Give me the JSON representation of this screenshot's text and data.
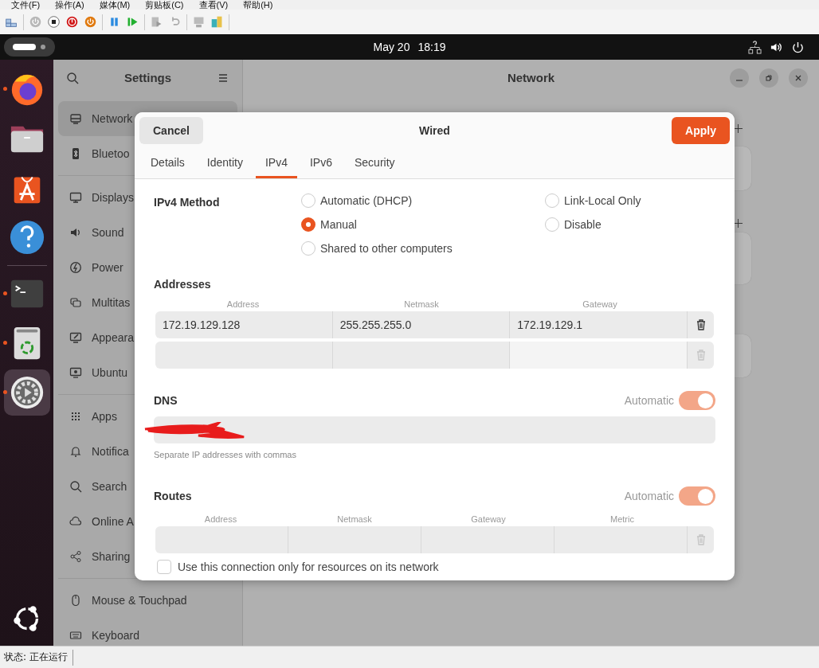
{
  "host_menu": [
    "文件(F)",
    "操作(A)",
    "媒体(M)",
    "剪贴板(C)",
    "查看(V)",
    "帮助(H)"
  ],
  "top_bar": {
    "date": "May 20",
    "time": "18:19"
  },
  "dock": [
    {
      "kind": "firefox",
      "running": true,
      "selected": false
    },
    {
      "kind": "files",
      "running": false,
      "selected": false
    },
    {
      "kind": "app-center",
      "running": false,
      "selected": false
    },
    {
      "kind": "help",
      "running": false,
      "selected": false
    },
    {
      "kind": "separator"
    },
    {
      "kind": "terminal",
      "running": true,
      "selected": false
    },
    {
      "kind": "trash",
      "running": true,
      "selected": false
    },
    {
      "kind": "settings",
      "running": true,
      "selected": true
    }
  ],
  "settings": {
    "title": "Settings",
    "groups": [
      [
        {
          "label": "Network",
          "selected": true
        },
        {
          "label": "Bluetoo",
          "selected": false
        }
      ],
      [
        {
          "label": "Displays",
          "selected": false
        },
        {
          "label": "Sound",
          "selected": false
        },
        {
          "label": "Power",
          "selected": false
        },
        {
          "label": "Multitas",
          "selected": false
        },
        {
          "label": "Appeara",
          "selected": false
        },
        {
          "label": "Ubuntu",
          "selected": false
        }
      ],
      [
        {
          "label": "Apps",
          "selected": false
        },
        {
          "label": "Notifica",
          "selected": false
        },
        {
          "label": "Search",
          "selected": false
        },
        {
          "label": "Online A",
          "selected": false
        },
        {
          "label": "Sharing",
          "selected": false
        }
      ],
      [
        {
          "label": "Mouse & Touchpad",
          "selected": false
        },
        {
          "label": "Keyboard",
          "selected": false
        }
      ]
    ]
  },
  "page": {
    "title": "Network"
  },
  "dialog": {
    "title": "Wired",
    "cancel": "Cancel",
    "apply": "Apply",
    "tabs": [
      {
        "label": "Details",
        "selected": false
      },
      {
        "label": "Identity",
        "selected": false
      },
      {
        "label": "IPv4",
        "selected": true
      },
      {
        "label": "IPv6",
        "selected": false
      },
      {
        "label": "Security",
        "selected": false
      }
    ],
    "method": {
      "label": "IPv4 Method",
      "options": [
        {
          "label": "Automatic (DHCP)",
          "selected": false
        },
        {
          "label": "Link-Local Only",
          "selected": false
        },
        {
          "label": "Manual",
          "selected": true
        },
        {
          "label": "Disable",
          "selected": false
        },
        {
          "label": "Shared to other computers",
          "selected": false
        }
      ]
    },
    "addresses": {
      "label": "Addresses",
      "columns": [
        "Address",
        "Netmask",
        "Gateway"
      ],
      "rows": [
        {
          "cells": [
            "172.19.129.128",
            "255.255.255.0",
            "172.19.129.1"
          ],
          "removable": true
        },
        {
          "cells": [],
          "removable": false
        }
      ]
    },
    "dns": {
      "label": "DNS",
      "switch_label": "Automatic",
      "automatic": true,
      "hint": "Separate IP addresses with commas",
      "redacted": true
    },
    "routes": {
      "label": "Routes",
      "switch_label": "Automatic",
      "automatic": true,
      "columns": [
        "Address",
        "Netmask",
        "Gateway",
        "Metric"
      ],
      "rows": [
        {
          "cells": [],
          "removable": false
        }
      ]
    },
    "restrict": {
      "label": "Use this connection only for resources on its network",
      "checked": false
    }
  },
  "status_bar": {
    "text": "状态: 正在运行"
  }
}
